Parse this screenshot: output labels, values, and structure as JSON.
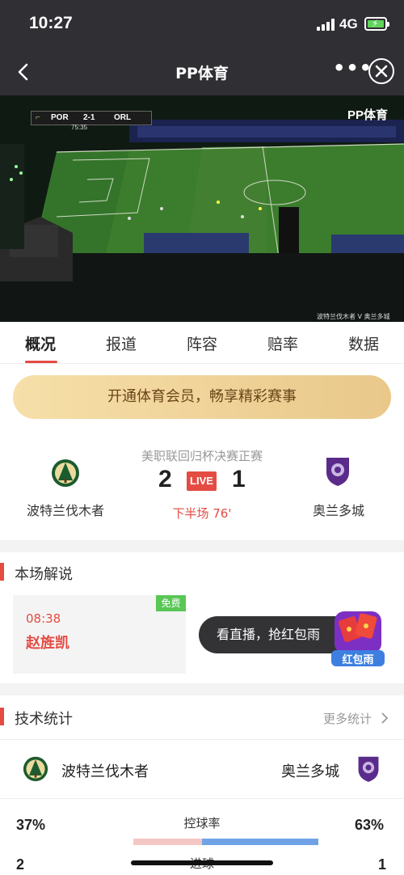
{
  "status_bar": {
    "time": "10:27",
    "network": "4G"
  },
  "nav": {
    "title": "PP体育",
    "more": "•••"
  },
  "video": {
    "score_bug": {
      "home": "POR",
      "score": "2-1",
      "away": "ORL",
      "clock": "75:35"
    },
    "logo": "PP体育",
    "watermark": "波特兰伐木者 V 奥兰多城"
  },
  "tabs": [
    {
      "label": "概况",
      "active": true
    },
    {
      "label": "报道"
    },
    {
      "label": "阵容"
    },
    {
      "label": "赔率"
    },
    {
      "label": "数据"
    }
  ],
  "vip_banner": "开通体育会员，畅享精彩赛事",
  "match": {
    "competition": "美职联回归杯决赛正赛",
    "home": {
      "name": "波特兰伐木者",
      "score": "2"
    },
    "away": {
      "name": "奥兰多城",
      "score": "1"
    },
    "live_badge": "LIVE",
    "period": "下半场 76'"
  },
  "commentary": {
    "title": "本场解说",
    "badge": "免费",
    "time": "08:38",
    "commentator": "赵旌凯",
    "toast": "看直播，抢红包雨",
    "redpack_label": "红包雨"
  },
  "stats": {
    "title": "技术统计",
    "more_label": "更多统计",
    "home_team": "波特兰伐木者",
    "away_team": "奥兰多城",
    "possession": {
      "label": "控球率",
      "home": "37%",
      "away": "63%",
      "home_fraction": 0.37,
      "away_fraction": 0.63
    },
    "goals": {
      "label": "进球",
      "home": "2",
      "away": "1"
    }
  },
  "colors": {
    "accent_red": "#e44b43",
    "portland_green": "#1c5b2f",
    "orlando_purple": "#5b2b8c",
    "vip_gold": "#f0d49a"
  },
  "icons": [
    "back-arrow-icon",
    "more-dots-icon",
    "close-circle-icon",
    "signal-icon",
    "battery-icon",
    "chevron-right-icon",
    "redpack-icon"
  ]
}
